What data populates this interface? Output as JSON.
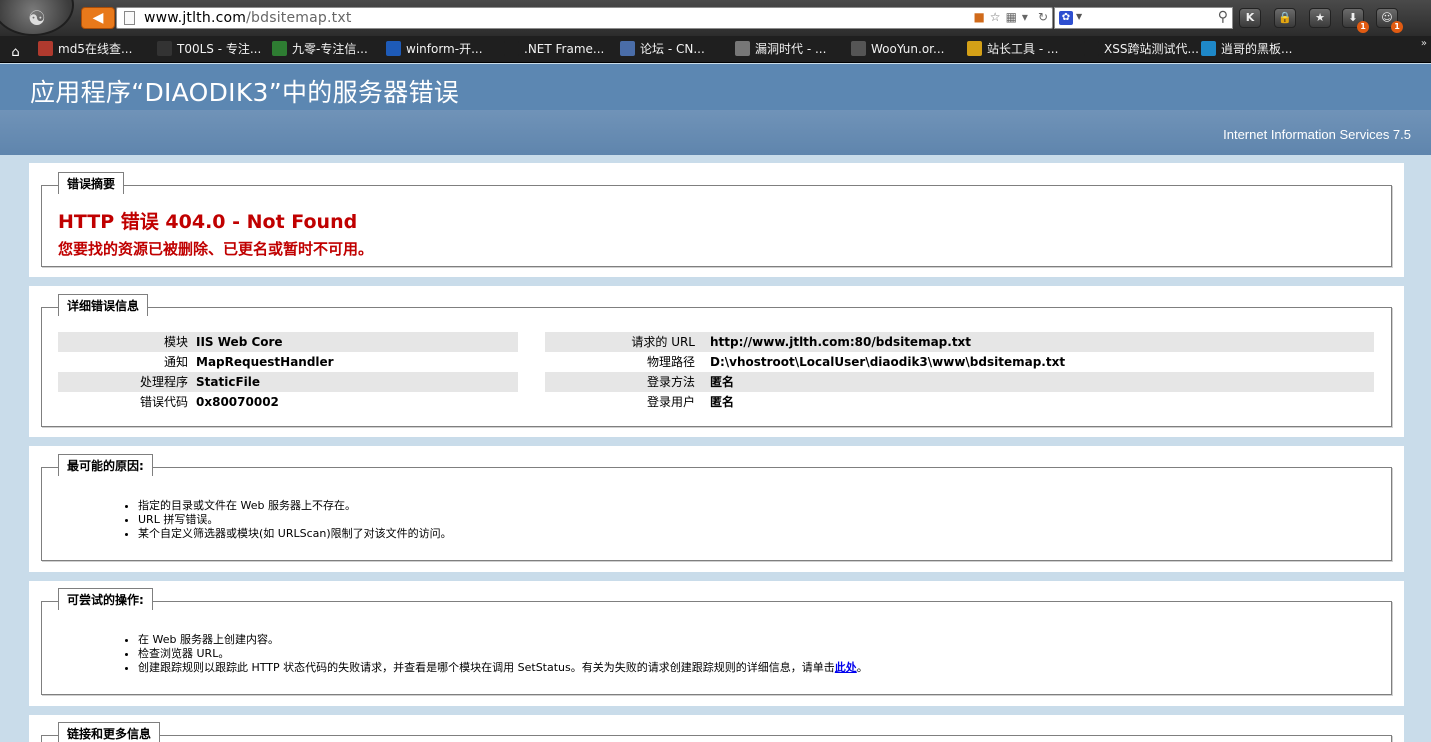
{
  "browser": {
    "url_host": "www.jtlth.com",
    "url_path": "/bdsitemap.txt",
    "search_placeholder": "",
    "toolbar": [
      {
        "name": "k-extension-button",
        "label": "K",
        "badge": ""
      },
      {
        "name": "lock-button",
        "label": "🔒",
        "badge": ""
      },
      {
        "name": "star-button",
        "label": "★",
        "badge": ""
      },
      {
        "name": "download-button",
        "label": "⬇",
        "badge": "1"
      },
      {
        "name": "addon-button",
        "label": "☺",
        "badge": "1"
      }
    ]
  },
  "bookmarks": [
    {
      "label": "md5在线查...",
      "color": "#b03a2e"
    },
    {
      "label": "T00LS - 专注...",
      "color": "#333333"
    },
    {
      "label": "九零-专注信...",
      "color": "#2e7d32"
    },
    {
      "label": "winform-开...",
      "color": "#1e5bb8"
    },
    {
      "label": ".NET Frame...",
      "color": "#1f1f1f"
    },
    {
      "label": "论坛   -    CN...",
      "color": "#4a6da8"
    },
    {
      "label": "漏洞时代 - ...",
      "color": "#777777"
    },
    {
      "label": "WooYun.or...",
      "color": "#555555"
    },
    {
      "label": "站长工具 - ...",
      "color": "#d4a017"
    },
    {
      "label": "XSS跨站测试代...",
      "color": "#1f1f1f"
    },
    {
      "label": "逍哥的黑板...",
      "color": "#1e88c8"
    }
  ],
  "iis": {
    "title": "应用程序“DIAODIK3”中的服务器错误",
    "version": "Internet Information Services 7.5",
    "summary": {
      "legend": "错误摘要",
      "error_title": "HTTP 错误 404.0 - Not Found",
      "error_message": "您要找的资源已被删除、已更名或暂时不可用。"
    },
    "details": {
      "legend": "详细错误信息",
      "left": [
        {
          "key": "模块",
          "value": "IIS Web Core"
        },
        {
          "key": "通知",
          "value": "MapRequestHandler"
        },
        {
          "key": "处理程序",
          "value": "StaticFile"
        },
        {
          "key": "错误代码",
          "value": "0x80070002"
        }
      ],
      "right": [
        {
          "key": "请求的 URL",
          "value": "http://www.jtlth.com:80/bdsitemap.txt"
        },
        {
          "key": "物理路径",
          "value": "D:\\vhostroot\\LocalUser\\diaodik3\\www\\bdsitemap.txt"
        },
        {
          "key": "登录方法",
          "value": "匿名"
        },
        {
          "key": "登录用户",
          "value": "匿名"
        }
      ]
    },
    "causes": {
      "legend": "最可能的原因:",
      "items": [
        "指定的目录或文件在 Web 服务器上不存在。",
        "URL 拼写错误。",
        "某个自定义筛选器或模块(如 URLScan)限制了对该文件的访问。"
      ]
    },
    "actions": {
      "legend": "可尝试的操作:",
      "items": [
        "在 Web 服务器上创建内容。",
        "检查浏览器 URL。"
      ],
      "last_item_prefix": "创建跟踪规则以跟踪此 HTTP 状态代码的失败请求，并查看是哪个模块在调用 SetStatus。有关为失败的请求创建跟踪规则的详细信息，请单击",
      "last_item_link": "此处",
      "last_item_suffix": "。"
    },
    "links": {
      "legend": "链接和更多信息"
    }
  }
}
